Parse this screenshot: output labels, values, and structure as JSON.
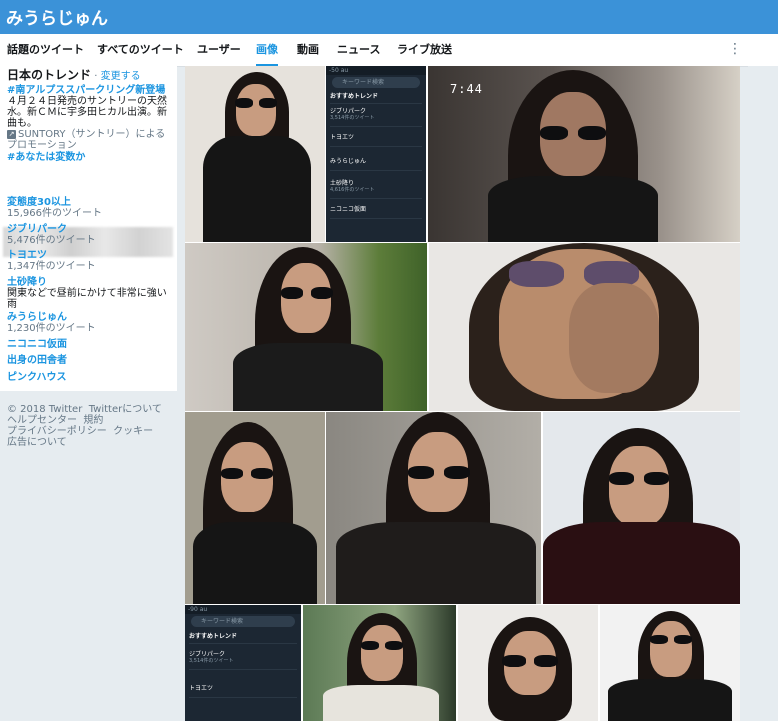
{
  "header": {
    "title": "みうらじゅん"
  },
  "nav": {
    "tabs": [
      {
        "label": "話題のツイート",
        "active": false
      },
      {
        "label": "すべてのツイート",
        "active": false
      },
      {
        "label": "ユーザー",
        "active": false
      },
      {
        "label": "画像",
        "active": true
      },
      {
        "label": "動画",
        "active": false
      },
      {
        "label": "ニュース",
        "active": false
      },
      {
        "label": "ライブ放送",
        "active": false
      }
    ],
    "more_icon": "more-vertical-icon",
    "more_glyph": "⋮"
  },
  "trends": {
    "title": "日本のトレンド",
    "separator": "·",
    "change_label": "変更する",
    "promoted": {
      "tag": "#南アルプススパークリング新登場",
      "desc": "４月２４日発売のサントリーの天然水。新ＣＭに宇多田ヒカル出演。新曲も。",
      "badge": "↗",
      "promo": "SUNTORY（サントリー）によるプロモーション"
    },
    "items": [
      {
        "label": "#あなたは変数か"
      },
      {
        "label": "変態度30以上",
        "count": "15,966件のツイート"
      },
      {
        "label": "ジブリパーク",
        "count": "5,476件のツイート"
      },
      {
        "label": "トヨエツ",
        "count": "1,347件のツイート"
      },
      {
        "label": "土砂降り",
        "desc": "関東などで昼前にかけて非常に強い雨"
      },
      {
        "label": "みうらじゅん",
        "count": "1,230件のツイート"
      },
      {
        "label": "ニコニコ仮面"
      },
      {
        "label": "出身の田舎者"
      },
      {
        "label": "ピンクハウス"
      }
    ]
  },
  "footer": {
    "line1a": "© 2018 Twitter",
    "line1b": "Twitterについて",
    "line2a": "ヘルプセンター",
    "line2b": "規約",
    "line3a": "プライバシーポリシー",
    "line3b": "クッキー",
    "line4": "広告について"
  },
  "photos": {
    "phone1": {
      "status": "-50 au",
      "search": "キーワード検索",
      "heading": "おすすめトレンド",
      "rows": [
        {
          "label": "ジブリパーク",
          "sub": "3,514件のツイート"
        },
        {
          "label": "トヨエツ"
        },
        {
          "label": "みうらじゅん"
        },
        {
          "label": "土砂降り",
          "sub": "4,616件のツイート"
        },
        {
          "label": "ニコニコ仮面"
        }
      ]
    },
    "clock": "7:44",
    "phone2": {
      "status": "-90 au",
      "search": "キーワード検索",
      "heading": "おすすめトレンド",
      "rows": [
        {
          "label": "ジブリパーク",
          "sub": "3,514件のツイート"
        },
        {
          "label": "トヨエツ"
        }
      ]
    }
  }
}
